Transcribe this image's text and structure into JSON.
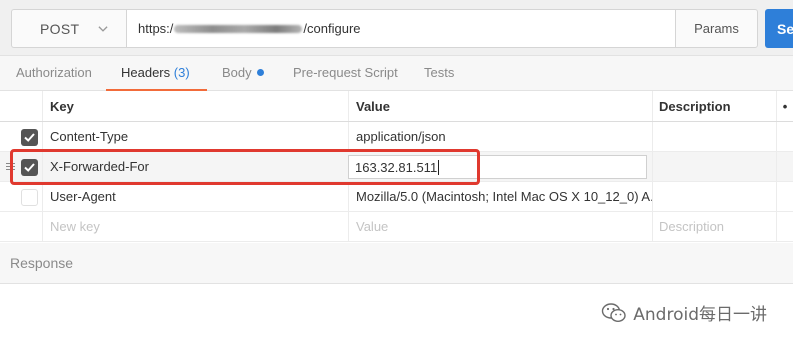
{
  "request": {
    "method": "POST",
    "url_prefix": "https:/",
    "url_suffix": "/configure",
    "params_label": "Params",
    "send_label": "Se"
  },
  "tabs": [
    {
      "label": "Authorization"
    },
    {
      "label": "Headers",
      "count": "(3)"
    },
    {
      "label": "Body"
    },
    {
      "label": "Pre-request Script"
    },
    {
      "label": "Tests"
    }
  ],
  "table": {
    "columns": {
      "key": "Key",
      "value": "Value",
      "description": "Description",
      "more": "•"
    },
    "rows": [
      {
        "key": "Content-Type",
        "value": "application/json",
        "checked": true
      },
      {
        "key": "X-Forwarded-For",
        "value": "163.32.81.511",
        "checked": true
      },
      {
        "key": "User-Agent",
        "value": "Mozilla/5.0 (Macintosh; Intel Mac OS X 10_12_0) A...",
        "checked": false
      }
    ],
    "new_row": {
      "key_placeholder": "New key",
      "value_placeholder": "Value",
      "description_placeholder": "Description"
    }
  },
  "response": {
    "label": "Response"
  },
  "watermark": {
    "text": "Android每日一讲"
  },
  "colors": {
    "accent": "#2e7fd9",
    "active_tab_underline": "#f26b3a",
    "highlight": "#e0392f"
  }
}
